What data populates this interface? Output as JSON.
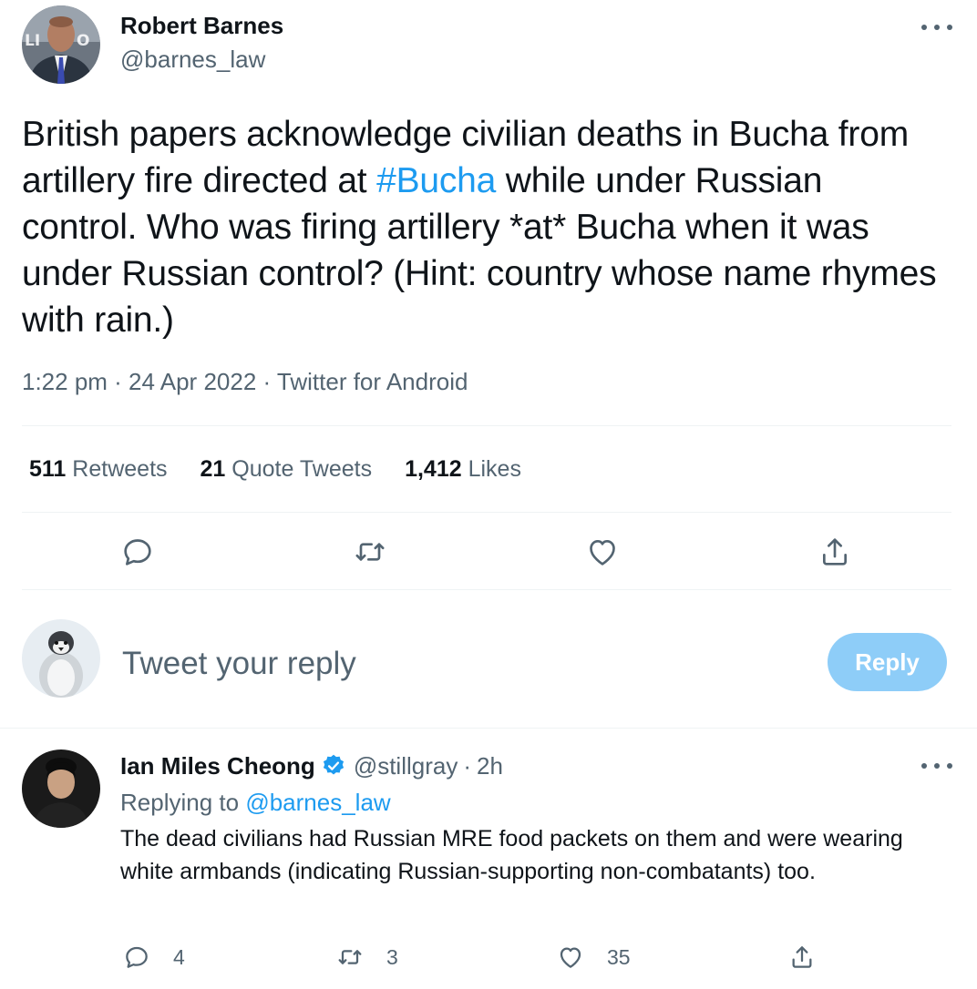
{
  "tweet": {
    "author": {
      "name": "Robert Barnes",
      "handle": "@barnes_law"
    },
    "text_before_hashtag": "British papers acknowledge civilian deaths in Bucha from artillery fire directed at ",
    "hashtag": "#Bucha",
    "text_after_hashtag": " while under Russian control. Who was firing artillery *at* Bucha when it was under Russian control? (Hint: country whose name rhymes with rain.)",
    "meta": "1:22 pm · 24 Apr 2022 · Twitter for Android",
    "stats": {
      "retweets_count": "511",
      "retweets_label": "Retweets",
      "quotes_count": "21",
      "quotes_label": "Quote Tweets",
      "likes_count": "1,412",
      "likes_label": "Likes"
    },
    "actions": [
      "reply-icon",
      "retweet-icon",
      "like-icon",
      "share-icon"
    ]
  },
  "composer": {
    "placeholder": "Tweet your reply",
    "button_label": "Reply"
  },
  "reply": {
    "author": {
      "name": "Ian Miles Cheong",
      "handle": "@stillgray",
      "separator": "·",
      "time": "2h",
      "verified": true
    },
    "replying_to_label": "Replying to",
    "replying_to_handle": "@barnes_law",
    "text": "The dead civilians had Russian MRE food packets on them and were wearing white armbands (indicating Russian-supporting non-combatants) too.",
    "counts": {
      "replies": "4",
      "retweets": "3",
      "likes": "35"
    }
  },
  "colors": {
    "accent": "#1d9bf0",
    "reply_button": "#8ecdf8",
    "secondary_text": "#536471",
    "primary_text": "#0f1419",
    "divider": "#eff3f4"
  }
}
